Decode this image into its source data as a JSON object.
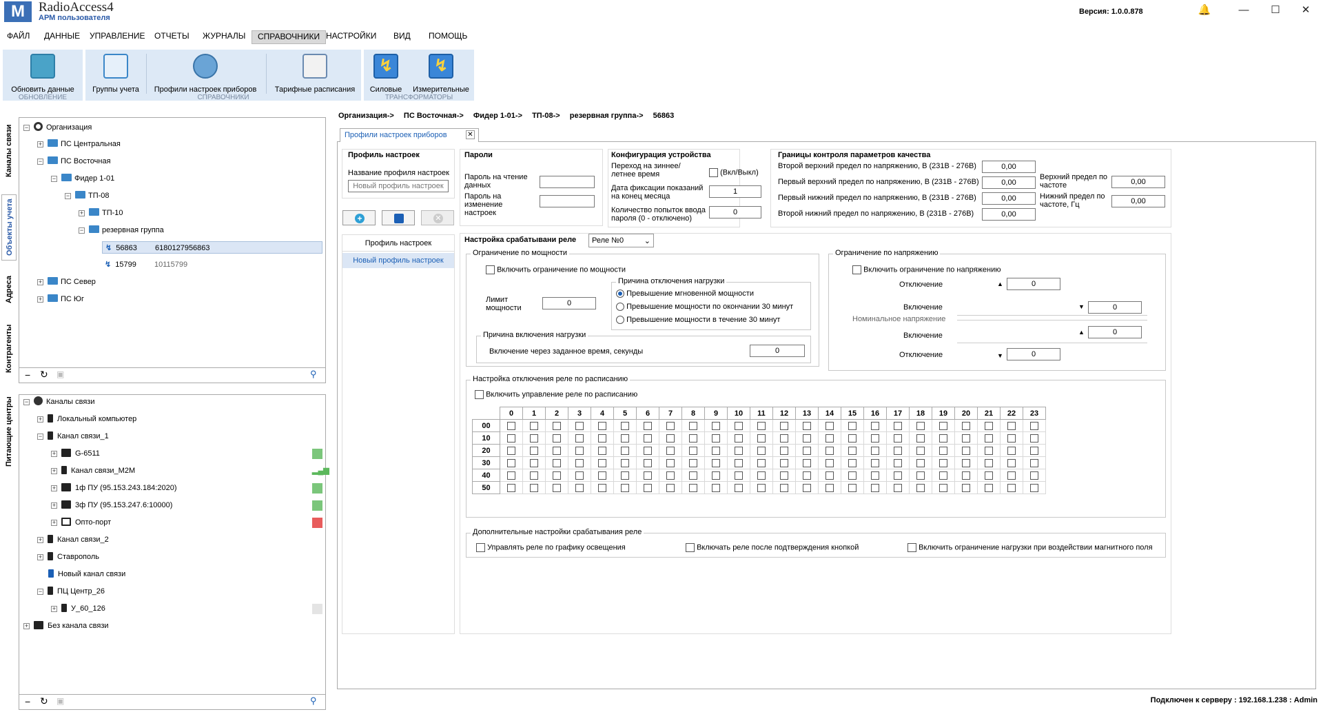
{
  "app": {
    "name": "RadioAccess4",
    "subtitle": "АРМ пользователя",
    "logo": "M",
    "version": "Версия:  1.0.0.878"
  },
  "menu": [
    "ФАЙЛ",
    "ДАННЫЕ",
    "УПРАВЛЕНИЕ",
    "ОТЧЕТЫ",
    "ЖУРНАЛЫ",
    "СПРАВОЧНИКИ",
    "НАСТРОЙКИ",
    "ВИД",
    "ПОМОЩЬ"
  ],
  "ribbon": {
    "update": {
      "label": "Обновить данные",
      "caption": "ОБНОВЛЕНИЕ"
    },
    "refs": {
      "groups": "Группы учета",
      "profiles": "Профили настроек приборов",
      "tariffs": "Тарифные расписания",
      "caption": "СПРАВОЧНИКИ"
    },
    "trans": {
      "power": "Силовые",
      "measure": "Измерительные",
      "caption": "ТРАНСФОРМАТОРЫ"
    }
  },
  "sidetabs": [
    "Каналы связи",
    "Объекты учета",
    "Адреса",
    "Контрагенты",
    "Питающие центры"
  ],
  "tree1": {
    "root": "Организация",
    "items": [
      "ПС Центральная",
      "ПС Восточная",
      "Фидер 1-01",
      "ТП-08",
      "ТП-10",
      "резервная группа",
      "ПС Север",
      "ПС Юг"
    ],
    "m1": {
      "id": "56863",
      "serial": "6180127956863"
    },
    "m2": {
      "id": "15799",
      "serial": "10115799"
    }
  },
  "tree2": {
    "root": "Каналы связи",
    "items": [
      "Локальный компьютер",
      "Канал связи_1",
      "G-6511",
      "Канал связи_M2M",
      "1ф ПУ (95.153.243.184:2020)",
      "3ф ПУ (95.153.247.6:10000)",
      "Опто-порт",
      "Канал связи_2",
      "Ставрополь",
      "Новый канал связи",
      "ПЦ Центр_26",
      "У_60_126",
      "Без канала связи"
    ]
  },
  "status_colors": {
    "green": "#7bc67b",
    "red": "#e85c5c",
    "grey": "#e4e4e4",
    "bars": "#5cb85c"
  },
  "breadcrumb": [
    "Организация->",
    "ПС Восточная->",
    "Фидер 1-01->",
    "ТП-08->",
    "резервная группа->",
    "56863"
  ],
  "tab": {
    "title": "Профили настроек приборов"
  },
  "profile": {
    "heading": "Профиль настроек",
    "name_label": "Название профиля настроек",
    "name_placeholder": "Новый профиль настроек",
    "list_header": "Профиль настроек",
    "list_item": "Новый профиль настроек"
  },
  "passwords": {
    "heading": "Пароли",
    "read": "Пароль на чтение данных",
    "change": "Пароль на изменение настроек"
  },
  "config": {
    "heading": "Конфигурация устройства",
    "dst": "Переход на зиннее/летнее время",
    "dst_cb": "(Вкл/Выкл)",
    "fix": "Дата фиксации показаний на конец месяца",
    "fix_val": "1",
    "attempts": "Количество попыток ввода пароля (0 - отключено)",
    "attempts_val": "0"
  },
  "quality": {
    "heading": "Границы контроля параметров качества",
    "rows": [
      {
        "label": "Второй верхний предел по напряжению, В (231В - 276В)",
        "val": "0,00"
      },
      {
        "label": "Первый  верхний предел по напряжению, В (231В - 276В)",
        "val": "0,00"
      },
      {
        "label": "Первый  нижний предел по напряжению, В (231В - 276В)",
        "val": "0,00"
      },
      {
        "label": "Второй нижний предел по напряжению, В (231В - 276В)",
        "val": "0,00"
      }
    ],
    "freq_up": "Верхний предел по частоте",
    "freq_up_val": "0,00",
    "freq_low": "Нижний предел по частоте, Гц",
    "freq_low_val": "0,00"
  },
  "relay": {
    "heading": "Настройка срабатывани реле",
    "select": "Реле №0"
  },
  "power_limit": {
    "title": "Ограничение по мощности",
    "enable": "Включить ограничение по мощности",
    "limit_label": "Лимит мощности",
    "limit_val": "0",
    "reason_title": "Причина отключения нагрузки",
    "reasons": [
      "Превышение мгновенной мощности",
      "Превышение мощности по окончании 30 минут",
      "Превышение мощности в течение 30 минут"
    ],
    "on_title": "Причина включения нагрузки",
    "on_label": "Включение через заданное время, секунды",
    "on_val": "0"
  },
  "voltage_limit": {
    "title": "Ограничение по напряжению",
    "enable": "Включить ограничение по напряжению",
    "off1": "Отключение",
    "off1_val": "0",
    "on1": "Включение",
    "on1_val": "0",
    "nominal": "Номинальное напряжение",
    "on2": "Включение",
    "on2_val": "0",
    "off2": "Отключение",
    "off2_val": "0"
  },
  "schedule": {
    "title": "Настройка отключения реле по расписанию",
    "enable": "Включить управление реле по расписанию",
    "hours": [
      "0",
      "1",
      "2",
      "3",
      "4",
      "5",
      "6",
      "7",
      "8",
      "9",
      "10",
      "11",
      "12",
      "13",
      "14",
      "15",
      "16",
      "17",
      "18",
      "19",
      "20",
      "21",
      "22",
      "23"
    ],
    "minutes": [
      "00",
      "10",
      "20",
      "30",
      "40",
      "50"
    ]
  },
  "extra": {
    "title": "Дополнительные настройки срабатывания реле",
    "opt1": "Управлять реле по графику освещения",
    "opt2": "Включать реле после подтверждения кнопкой",
    "opt3": "Включить ограничение нагрузки при воздействии магнитного поля"
  },
  "status": "Подключен к серверу : 192.168.1.238 : Admin"
}
